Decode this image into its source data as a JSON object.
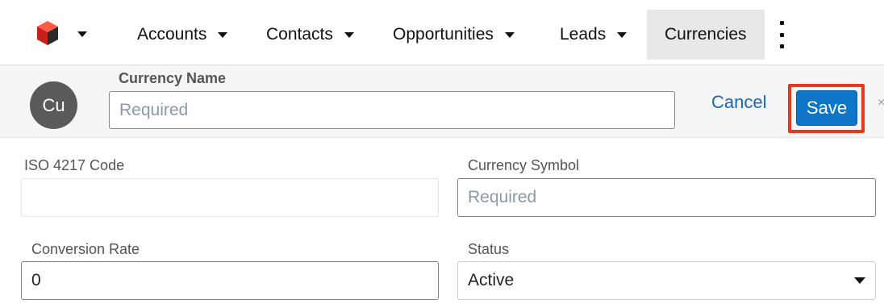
{
  "nav": {
    "items": [
      {
        "label": "Accounts"
      },
      {
        "label": "Contacts"
      },
      {
        "label": "Opportunities"
      },
      {
        "label": "Leads"
      },
      {
        "label": "Currencies"
      }
    ]
  },
  "record": {
    "avatar_initials": "Cu",
    "name_label": "Currency Name",
    "name_placeholder": "Required",
    "cancel_label": "Cancel",
    "save_label": "Save",
    "close_glyph": "×"
  },
  "form": {
    "iso_label": "ISO 4217 Code",
    "iso_value": "",
    "symbol_label": "Currency Symbol",
    "symbol_placeholder": "Required",
    "rate_label": "Conversion Rate",
    "rate_value": "0",
    "status_label": "Status",
    "status_value": "Active"
  },
  "colors": {
    "accent": "#0f75c7",
    "link": "#1c67b4",
    "highlight": "#e53a1e",
    "avatar": "#5a5a5a",
    "logo": "#e0261b"
  },
  "icons": [
    "sugar-cube-logo-icon",
    "chevron-down-icon",
    "kebab-menu-icon",
    "close-icon"
  ]
}
